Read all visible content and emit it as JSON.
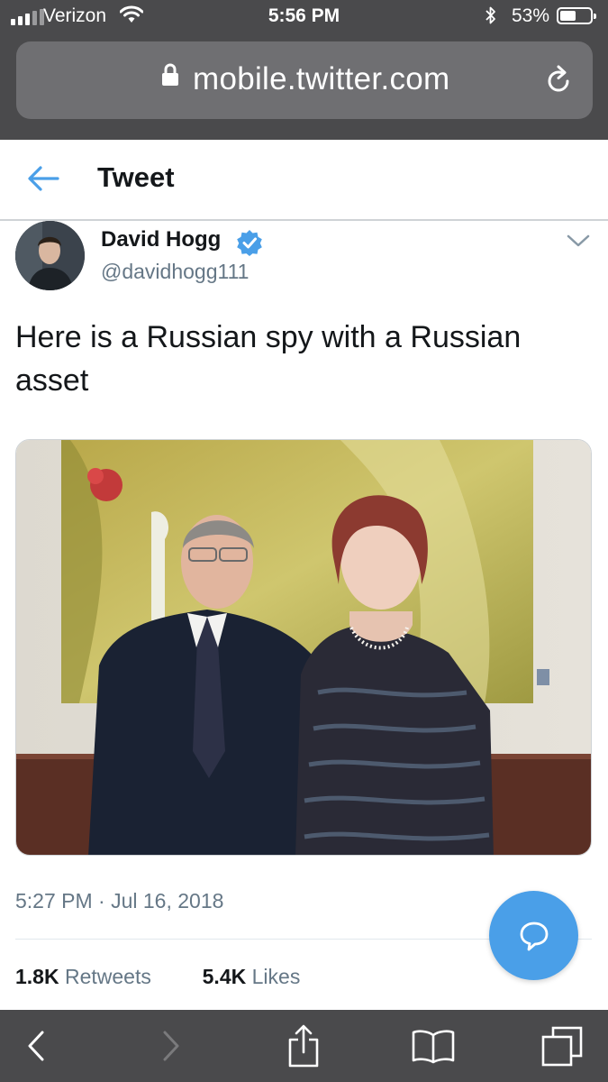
{
  "status_bar": {
    "carrier": "Verizon",
    "time": "5:56 PM",
    "battery_percent": "53%",
    "battery_level": 0.53,
    "signal_bars_filled": 3,
    "signal_bars_total": 5
  },
  "browser": {
    "url": "mobile.twitter.com"
  },
  "header": {
    "title": "Tweet"
  },
  "tweet": {
    "author_name": "David Hogg",
    "author_handle": "@davidhogg111",
    "text": "Here is a Russian spy with a Russian asset",
    "timestamp": "5:27 PM · Jul 16, 2018",
    "retweets_count": "1.8K",
    "retweets_label": "Retweets",
    "likes_count": "5.4K",
    "likes_label": "Likes"
  },
  "colors": {
    "twitter_blue": "#4a9fe8",
    "verified_blue": "#4a9fe8",
    "chrome_gray": "#4a4a4c",
    "secondary_text": "#657786"
  },
  "icons": {
    "back": "left-arrow-icon",
    "verified": "verified-badge-icon",
    "more": "chevron-down-icon",
    "compose": "reply-bubble-icon",
    "lock": "lock-icon",
    "reload": "reload-icon",
    "toolbar": [
      "back-chevron-icon",
      "forward-chevron-icon",
      "share-icon",
      "bookmarks-icon",
      "tabs-icon"
    ]
  }
}
